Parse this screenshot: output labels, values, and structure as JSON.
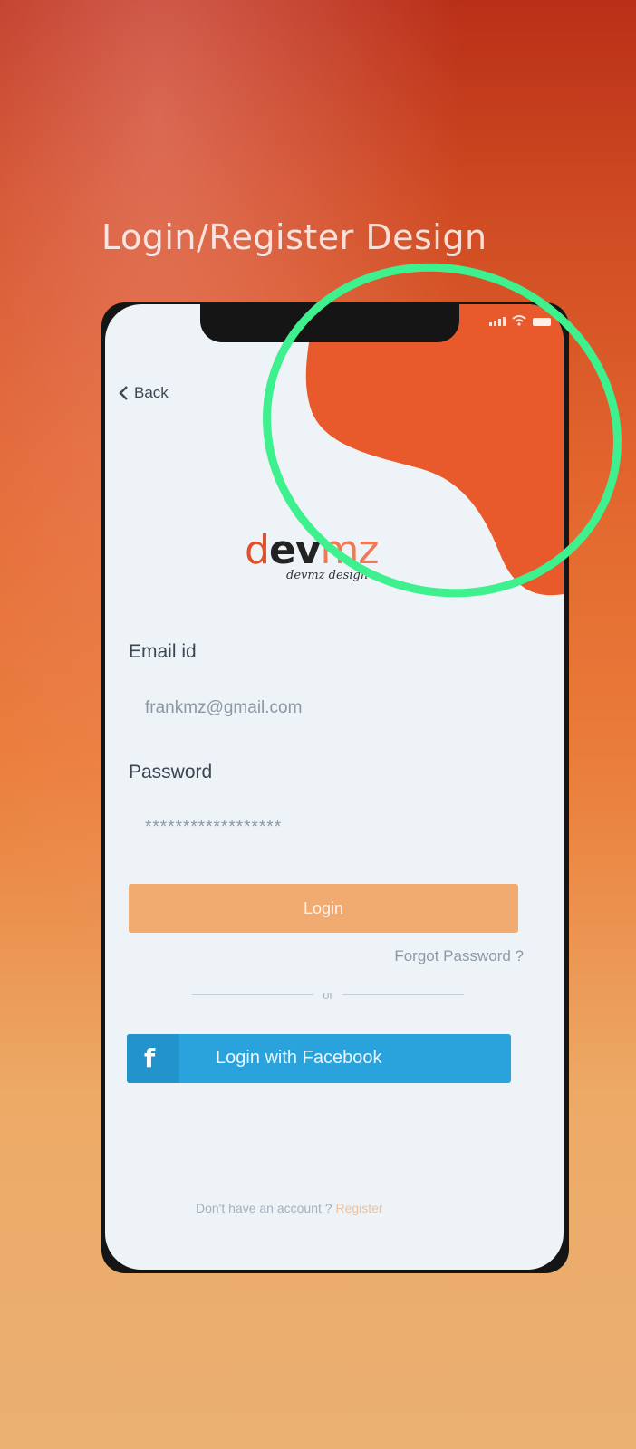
{
  "page": {
    "title": "Login/Register Design"
  },
  "status_bar": {
    "icons": [
      "signal-icon",
      "wifi-icon",
      "battery-icon"
    ]
  },
  "nav": {
    "back_label": "Back",
    "back_icon": "chevron-left-icon"
  },
  "logo": {
    "part_1": "d",
    "part_2": "ev",
    "part_3": "mz",
    "tagline": "devmz design"
  },
  "form": {
    "email_label": "Email id",
    "email_value": "frankmz@gmail.com",
    "password_label": "Password",
    "password_value": "******************",
    "login_label": "Login",
    "forgot_label": "Forgot Password ?",
    "divider_text": "or",
    "facebook_icon": "f",
    "facebook_label": "Login with Facebook"
  },
  "footer": {
    "prompt": "Don't have an account ?",
    "register_label": "Register"
  },
  "colors": {
    "accent": "#e85a2c",
    "login_button": "#f1aa70",
    "facebook": "#2aa3dc",
    "annotation": "#3ef08e"
  }
}
